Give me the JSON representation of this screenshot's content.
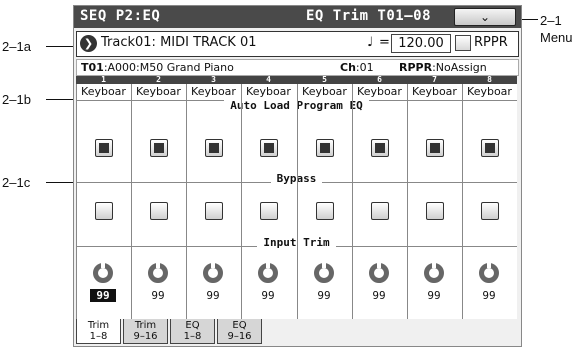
{
  "callouts": {
    "c_2_1": "2–1",
    "c_menu": "Menu",
    "c_2_1a": "2–1a",
    "c_2_1b": "2–1b",
    "c_2_1c": "2–1c"
  },
  "titlebar": {
    "left": "SEQ P2:EQ",
    "right": "EQ Trim T01–08",
    "menu_icon": "⌄"
  },
  "track": {
    "arrow_icon": "❯",
    "name": "Track01: MIDI TRACK 01",
    "note_icon": "♩",
    "eq_sign": "=",
    "tempo": "120.00",
    "rppr_label": "RPPR",
    "rppr_checked": false
  },
  "info": {
    "prog_key": "T01",
    "prog_val": ":A000:M50 Grand Piano",
    "ch_key": "Ch",
    "ch_val": ":01",
    "rppr_key": "RPPR",
    "rppr_val": ":NoAssign"
  },
  "channels": [
    {
      "num": "1",
      "source": "Keyboar",
      "auto_load": true,
      "bypass": false,
      "trim": "99"
    },
    {
      "num": "2",
      "source": "Keyboar",
      "auto_load": true,
      "bypass": false,
      "trim": "99"
    },
    {
      "num": "3",
      "source": "Keyboar",
      "auto_load": true,
      "bypass": false,
      "trim": "99"
    },
    {
      "num": "4",
      "source": "Keyboar",
      "auto_load": true,
      "bypass": false,
      "trim": "99"
    },
    {
      "num": "5",
      "source": "Keyboar",
      "auto_load": true,
      "bypass": false,
      "trim": "99"
    },
    {
      "num": "6",
      "source": "Keyboar",
      "auto_load": true,
      "bypass": false,
      "trim": "99"
    },
    {
      "num": "7",
      "source": "Keyboar",
      "auto_load": true,
      "bypass": false,
      "trim": "99"
    },
    {
      "num": "8",
      "source": "Keyboar",
      "auto_load": true,
      "bypass": false,
      "trim": "99"
    }
  ],
  "sections": {
    "auto_load": "Auto Load Program EQ",
    "bypass": "Bypass",
    "input_trim": "Input Trim"
  },
  "tabs": [
    {
      "line1": "Trim",
      "line2": "1–8",
      "active": true
    },
    {
      "line1": "Trim",
      "line2": "9–16",
      "active": false
    },
    {
      "line1": "EQ",
      "line2": "1–8",
      "active": false
    },
    {
      "line1": "EQ",
      "line2": "9–16",
      "active": false
    }
  ],
  "colors": {
    "titlebar": "#4a4a4a",
    "screen_bg": "#f0f0f0"
  }
}
